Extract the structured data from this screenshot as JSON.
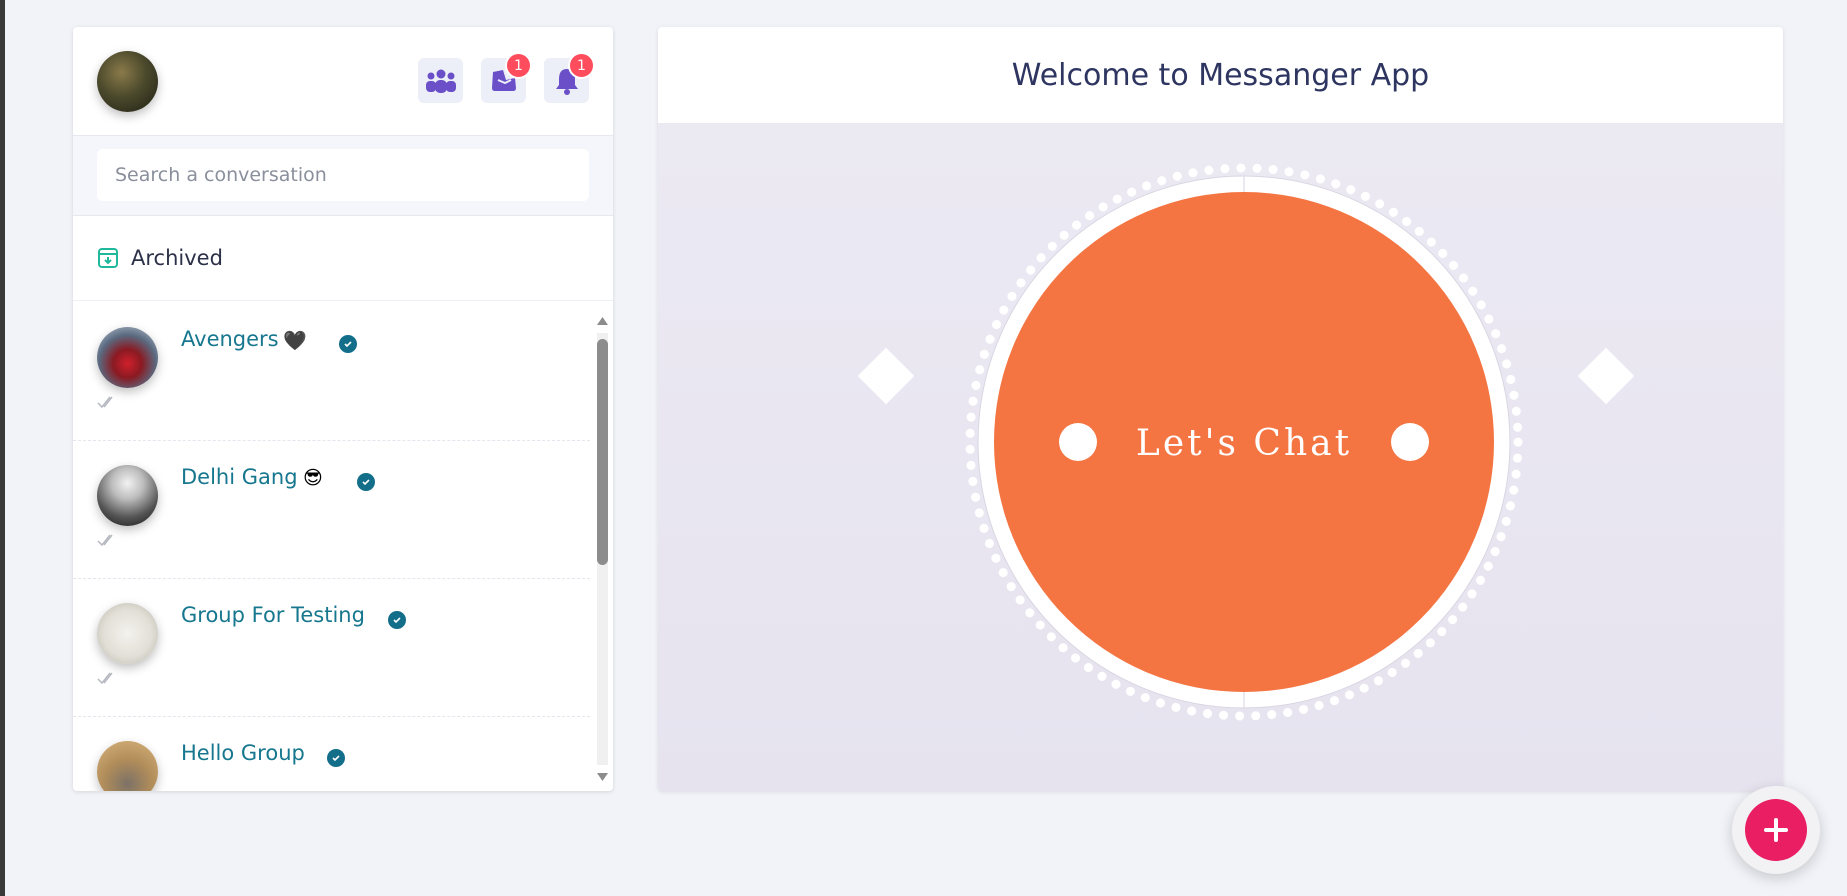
{
  "sidebar": {
    "header": {
      "groups_label": "",
      "inbox_badge": "1",
      "notifications_badge": "1"
    },
    "search": {
      "placeholder": "Search a conversation",
      "value": ""
    },
    "archived_label": "Archived",
    "conversations": [
      {
        "name": "Avengers",
        "emoji": "🖤"
      },
      {
        "name": "Delhi Gang",
        "emoji": "😎"
      },
      {
        "name": "Group For Testing",
        "emoji": ""
      },
      {
        "name": "Hello Group",
        "emoji": ""
      }
    ]
  },
  "main": {
    "title": "Welcome to Messanger App",
    "hero_label": "Let's Chat"
  },
  "colors": {
    "accent_teal": "#16778e",
    "hero_orange": "#f47442",
    "fab_pink": "#e91e63",
    "badge_red": "#ff4d5e",
    "icon_purple": "#6a4fc9"
  }
}
